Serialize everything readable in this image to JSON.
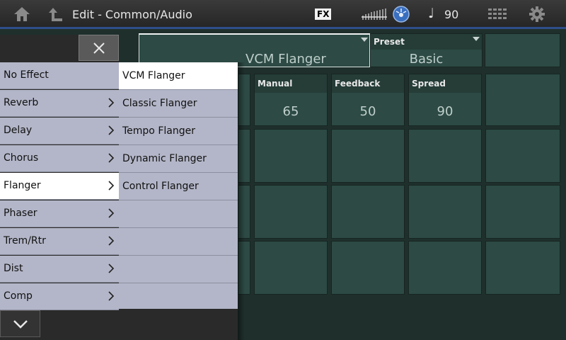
{
  "header": {
    "title": "Edit - Common/Audio",
    "fx_badge": "FX",
    "tempo": "90",
    "tempo_note": "♩"
  },
  "effect": {
    "type_value": "VCM Flanger",
    "preset_label": "Preset",
    "preset_value": "Basic",
    "params": [
      {
        "label": "Manual",
        "value": "65"
      },
      {
        "label": "Feedback",
        "value": "50"
      },
      {
        "label": "Spread",
        "value": "90"
      }
    ]
  },
  "categories": [
    {
      "label": "No Effect",
      "has_sub": false,
      "selected": false
    },
    {
      "label": "Reverb",
      "has_sub": true,
      "selected": false
    },
    {
      "label": "Delay",
      "has_sub": true,
      "selected": false
    },
    {
      "label": "Chorus",
      "has_sub": true,
      "selected": false
    },
    {
      "label": "Flanger",
      "has_sub": true,
      "selected": true
    },
    {
      "label": "Phaser",
      "has_sub": true,
      "selected": false
    },
    {
      "label": "Trem/Rtr",
      "has_sub": true,
      "selected": false
    },
    {
      "label": "Dist",
      "has_sub": true,
      "selected": false
    },
    {
      "label": "Comp",
      "has_sub": true,
      "selected": false
    }
  ],
  "types": [
    {
      "label": "VCM Flanger",
      "selected": true
    },
    {
      "label": "Classic Flanger",
      "selected": false
    },
    {
      "label": "Tempo Flanger",
      "selected": false
    },
    {
      "label": "Dynamic Flanger",
      "selected": false
    },
    {
      "label": "Control Flanger",
      "selected": false
    },
    {
      "label": "",
      "selected": false
    },
    {
      "label": "",
      "selected": false
    },
    {
      "label": "",
      "selected": false
    },
    {
      "label": "",
      "selected": false
    }
  ],
  "icons": {
    "home": "home-icon",
    "up": "up-arrow-icon",
    "slider": "slider-icon",
    "disc": "disc-icon",
    "grid": "grid-icon",
    "gear": "gear-icon",
    "close": "close-icon",
    "down": "chevron-down-icon"
  },
  "colors": {
    "accent_line": "#2d4e8a",
    "menu_bg": "#b3b6c8",
    "menu_selected": "#ffffff",
    "cell_bg": "#2d4a44"
  }
}
